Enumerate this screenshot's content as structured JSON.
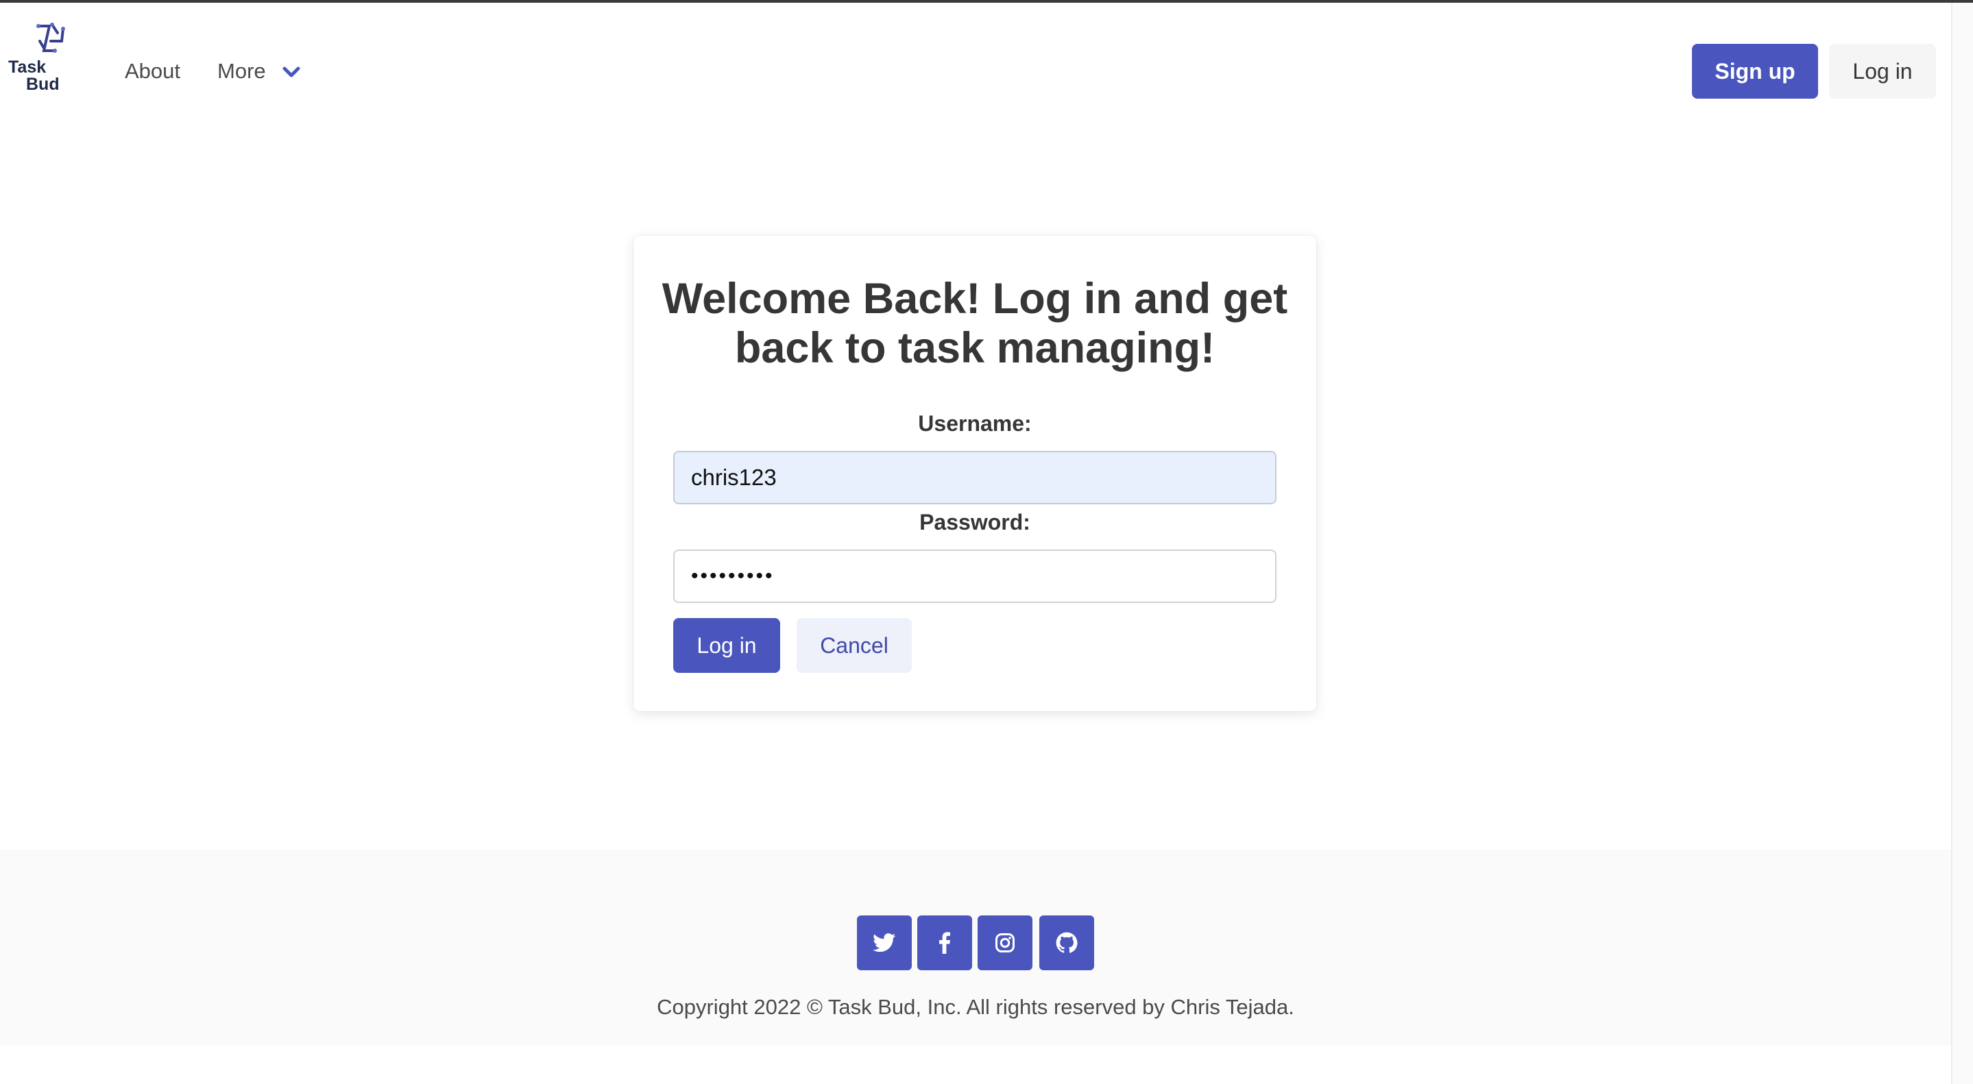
{
  "navbar": {
    "logo_line1": "Task",
    "logo_line2": "Bud",
    "about_label": "About",
    "more_label": "More",
    "signup_label": "Sign up",
    "login_label": "Log in"
  },
  "login_card": {
    "title_line1": "Welcome Back! Log in and get",
    "title_line2": "back to task managing!",
    "username_label": "Username:",
    "username_value": "chris123",
    "password_label": "Password:",
    "password_value": "•••••••••",
    "submit_label": "Log in",
    "cancel_label": "Cancel"
  },
  "footer": {
    "social_icons": [
      "twitter-icon",
      "facebook-icon",
      "instagram-icon",
      "github-icon"
    ],
    "copyright": "Copyright 2022 © Task Bud, Inc. All rights reserved by Chris Tejada."
  },
  "colors": {
    "primary": "#4a56bd",
    "input_autofill": "#e8effd",
    "footer_bg": "#fafafa"
  }
}
